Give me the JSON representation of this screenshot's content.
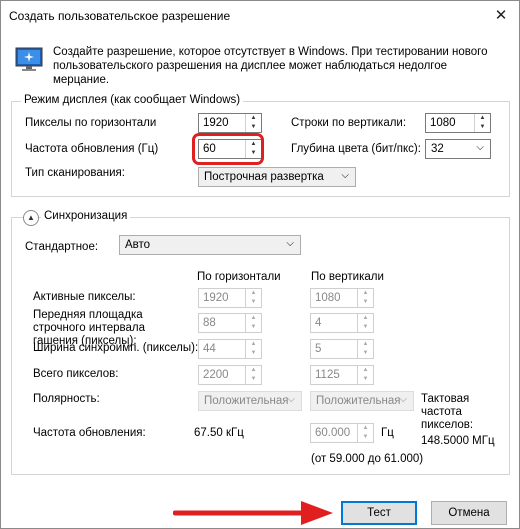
{
  "window": {
    "title": "Создать пользовательское разрешение",
    "close_glyph": "✕"
  },
  "intro_text": "Создайте разрешение, которое отсутствует в Windows. При тестировании нового пользовательского разрешения на дисплее может наблюдаться недолгое мерцание.",
  "display_mode": {
    "legend": "Режим дисплея (как сообщает Windows)",
    "h_pixels_label": "Пикселы по горизонтали",
    "h_pixels_value": "1920",
    "v_lines_label": "Строки по вертикали:",
    "v_lines_value": "1080",
    "refresh_label": "Частота обновления (Гц)",
    "refresh_value": "60",
    "color_depth_label": "Глубина цвета (бит/пкс):",
    "color_depth_value": "32",
    "scan_type_label": "Тип сканирования:",
    "scan_type_value": "Построчная развертка"
  },
  "sync": {
    "legend": "Синхронизация",
    "standard_label": "Стандартное:",
    "standard_value": "Авто",
    "col_horizontal": "По горизонтали",
    "col_vertical": "По вертикали",
    "rows": [
      {
        "label": "Активные пикселы:",
        "h": "1920",
        "v": "1080"
      },
      {
        "label": "Передняя площадка строчного интервала гашения (пикселы):",
        "h": "88",
        "v": "4"
      },
      {
        "label": "Ширина синхроимп. (пикселы):",
        "h": "44",
        "v": "5"
      },
      {
        "label": "Всего пикселов:",
        "h": "2200",
        "v": "1125"
      }
    ],
    "polarity_label": "Полярность:",
    "polarity_h": "Положительная",
    "polarity_v": "Положительная",
    "refresh_label": "Частота обновления:",
    "refresh_h": "67.50 кГц",
    "refresh_v": "60.000",
    "refresh_unit": "Гц",
    "refresh_range": "(от 59.000 до 61.000)",
    "pixel_clock_label": "Тактовая частота пикселов:",
    "pixel_clock_value": "148.5000 МГц"
  },
  "buttons": {
    "test": "Тест",
    "cancel": "Отмена"
  },
  "colors": {
    "highlight": "#e02020",
    "arrow": "#e02020",
    "default_button_border": "#0078d7"
  }
}
